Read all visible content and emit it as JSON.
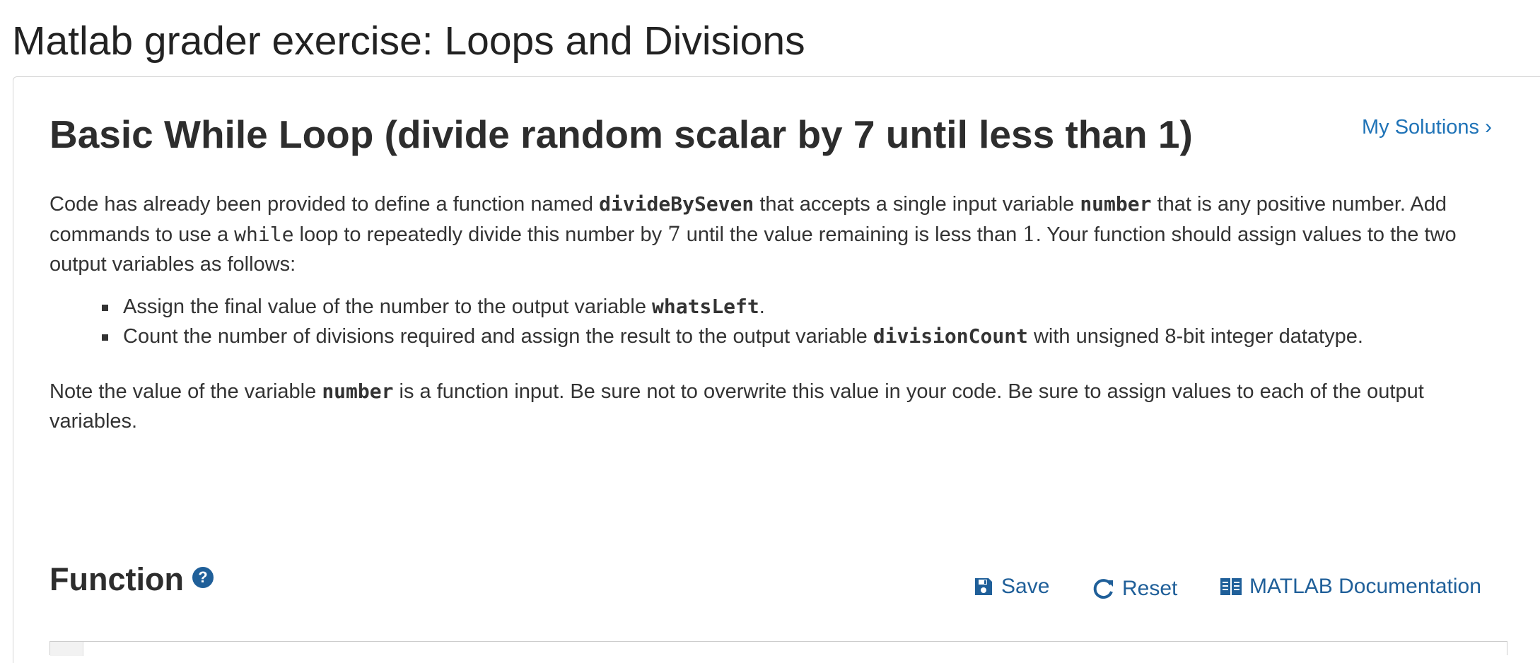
{
  "page": {
    "title": "Matlab grader exercise: Loops and Divisions"
  },
  "problem": {
    "title": "Basic While Loop (divide random scalar by 7 until less than 1)",
    "my_solutions_label": "My Solutions",
    "my_solutions_chevron": "›",
    "description": {
      "t1": "Code has already been provided to define a function named ",
      "fn_name": "divideBySeven",
      "t2": " that accepts a single input variable ",
      "input_var": "number",
      "t3": " that is any positive number. Add commands to use a ",
      "loop_kw": "while",
      "t4": " loop to repeatedly divide this number by ",
      "divisor": "7",
      "t5": " until the value remaining is less than ",
      "threshold": "1",
      "t6": ". Your function should assign values to the two output variables as follows:"
    },
    "bullets": [
      {
        "pre": "Assign the final value of the number to the output variable ",
        "code": "whatsLeft",
        "post": "."
      },
      {
        "pre": "Count the number of divisions required and assign the result to the output variable ",
        "code": "divisionCount",
        "post": " with unsigned 8-bit integer datatype."
      }
    ],
    "note": {
      "pre": "Note the value of the variable ",
      "code": "number",
      "post": " is a function input. Be sure not to overwrite this value in your code. Be sure to assign values to each of the output variables."
    }
  },
  "function_section": {
    "heading": "Function",
    "help_icon": "question-circle-icon",
    "help_glyph": "?",
    "toolbar": {
      "save_label": "Save",
      "save_icon": "floppy-disk-icon",
      "reset_label": "Reset",
      "reset_icon": "refresh-icon",
      "docs_label": "MATLAB Documentation",
      "docs_icon": "open-book-icon"
    }
  },
  "colors": {
    "link": "#1f73b7",
    "toolbar": "#1f5f99",
    "text": "#333333"
  }
}
